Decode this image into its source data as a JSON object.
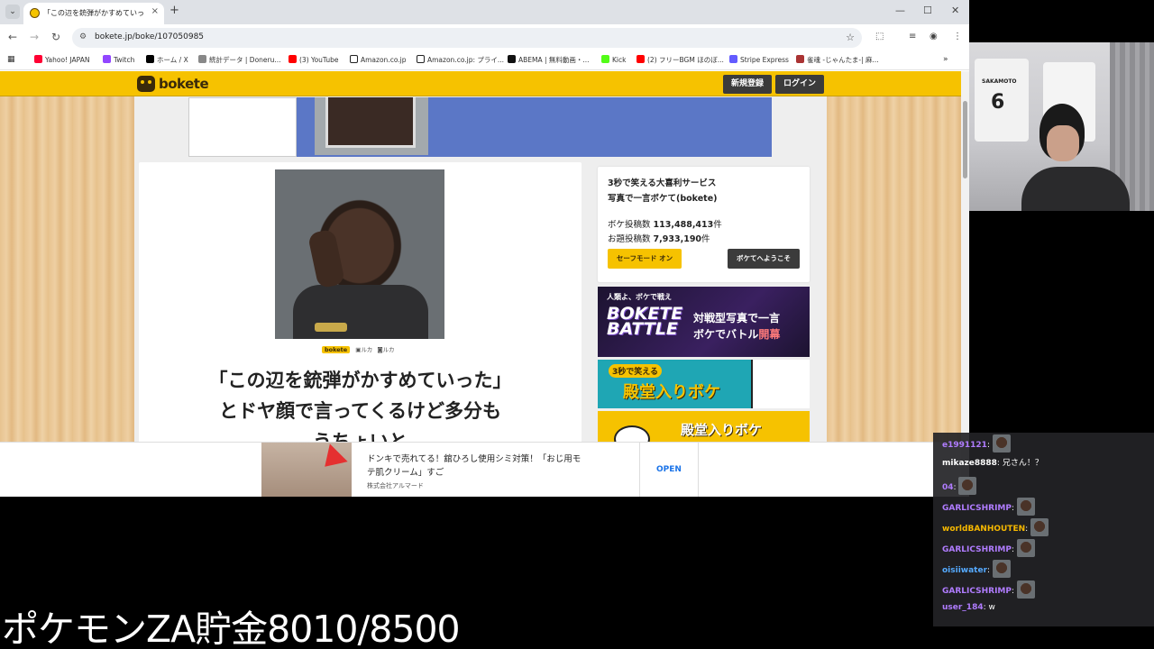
{
  "browser": {
    "tab_title": "「この辺を銃弾がかすめていった」とド",
    "tab_close": "×",
    "new_tab": "+",
    "url": "bokete.jp/boke/107050985",
    "window_controls": [
      "—",
      "☐",
      "✕"
    ],
    "bookmarks": [
      {
        "label": "Yahoo! JAPAN",
        "color": "#ff0033"
      },
      {
        "label": "Twitch",
        "color": "#9146ff"
      },
      {
        "label": "ホーム / X",
        "color": "#000000"
      },
      {
        "label": "統計データ | Doneru...",
        "color": "#555555"
      },
      {
        "label": "(3) YouTube",
        "color": "#ff0000"
      },
      {
        "label": "Amazon.co.jp",
        "color": "#222222"
      },
      {
        "label": "Amazon.co.jp: プライ...",
        "color": "#222222"
      },
      {
        "label": "ABEMA | 無料動画・...",
        "color": "#111111"
      },
      {
        "label": "Kick",
        "color": "#53fc18"
      },
      {
        "label": "(2) フリーBGM ほのぼ...",
        "color": "#ff0000"
      },
      {
        "label": "Stripe Express",
        "color": "#635bff"
      },
      {
        "label": "雀魂 -じゃんたま-| 麻...",
        "color": "#a33"
      }
    ]
  },
  "site": {
    "logo": "bokete",
    "signup_label": "新規登録",
    "login_label": "ログイン",
    "brand_color": "#f6c200"
  },
  "boke": {
    "credit_logo": "bokete",
    "credit_photo": "ルカ",
    "credit_camera": "ルカ",
    "text_line1": "「この辺を銃弾がかすめていった」",
    "text_line2": "とドヤ顔で言ってくるけど多分も",
    "text_line3": "うちょいと"
  },
  "sidebar": {
    "tagline1": "3秒で笑える大喜利サービス",
    "tagline2": "写真で一言ボケて(bokete)",
    "boke_count_label": "ボケ投稿数",
    "boke_count": "113,488,413",
    "boke_count_unit": "件",
    "odai_count_label": "お題投稿数",
    "odai_count": "7,933,190",
    "odai_count_unit": "件",
    "safe_mode_label": "セーフモード オン",
    "welcome_label": "ボケてへようこそ"
  },
  "ads": {
    "battle_head": "人類よ、ボケで戦え",
    "battle_logo1": "BOKETE",
    "battle_logo2": "BATTLE",
    "battle_copy1": "対戦型写真で一言",
    "battle_copy2a": "ボケでバトル",
    "battle_copy2b": "開幕",
    "hall1_small": "3秒で笑える",
    "hall1_big": "殿堂入りボケ",
    "hall2_big": "殿堂入りボケ",
    "bottom_line1": "ドンキで売れてる！舘ひろし使用シミ対策！「おじ用モ",
    "bottom_line2": "テ肌クリーム」すご",
    "bottom_advertiser": "株式会社アルマード",
    "bottom_open": "OPEN"
  },
  "webcam": {
    "jersey_name": "SAKAMOTO",
    "jersey_number": "6"
  },
  "chat": [
    {
      "user": "e1991121",
      "msg": "",
      "color": "#b07cff",
      "emote": true
    },
    {
      "user": "mikaze8888",
      "msg": "兄さん！？",
      "color": "#ffffff",
      "emote": false
    },
    {
      "user": "04",
      "msg": "",
      "color": "#b07cff",
      "emote": true
    },
    {
      "user": "GARLICSHRIMP",
      "msg": "",
      "color": "#b07cff",
      "emote": true
    },
    {
      "user": "worldBANHOUTEN",
      "msg": "",
      "color": "#f6b800",
      "emote": true
    },
    {
      "user": "GARLICSHRIMP",
      "msg": "",
      "color": "#b07cff",
      "emote": true
    },
    {
      "user": "oisiiwater",
      "msg": "",
      "color": "#55aaff",
      "emote": true
    },
    {
      "user": "GARLICSHRIMP",
      "msg": "",
      "color": "#b07cff",
      "emote": true
    },
    {
      "user": "user_184",
      "msg": "w",
      "color": "#b07cff",
      "emote": false
    }
  ],
  "caption": "ポケモンZA貯金8010/8500"
}
